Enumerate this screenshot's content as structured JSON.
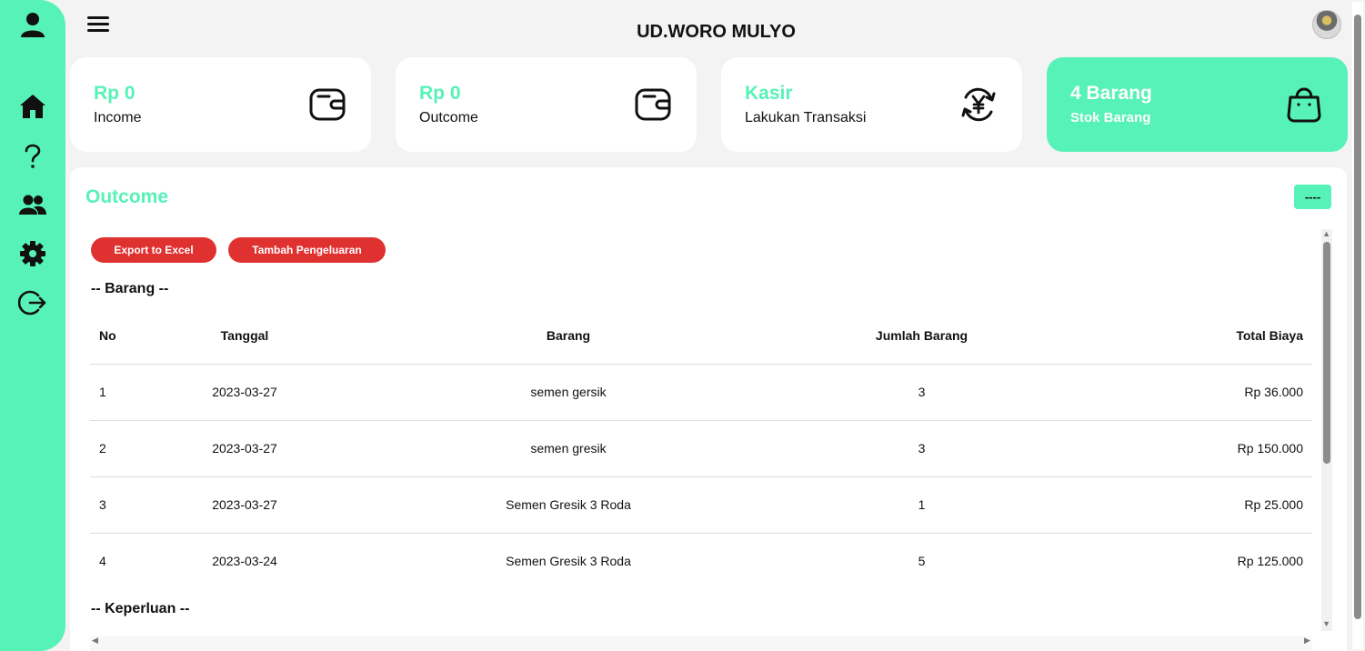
{
  "header": {
    "title": "UD.WORO MULYO"
  },
  "sidebar": {
    "items": [
      "user-icon",
      "home-icon",
      "help-icon",
      "users-icon",
      "gear-icon",
      "logout-icon"
    ]
  },
  "cards": [
    {
      "value": "Rp 0",
      "label": "Income",
      "icon": "wallet-icon"
    },
    {
      "value": "Rp 0",
      "label": "Outcome",
      "icon": "wallet-icon"
    },
    {
      "value": "Kasir",
      "label": "Lakukan Transaksi",
      "icon": "yen-exchange-icon"
    },
    {
      "value": "4 Barang",
      "label": "Stok Barang",
      "icon": "bag-icon"
    }
  ],
  "panel": {
    "title": "Outcome",
    "menu_label": "----",
    "export_label": "Export to Excel",
    "add_label": "Tambah Pengeluaran",
    "section_barang": "-- Barang --",
    "section_keperluan": "-- Keperluan --"
  },
  "table": {
    "headers": [
      "No",
      "Tanggal",
      "Barang",
      "Jumlah Barang",
      "Total Biaya"
    ],
    "rows": [
      [
        "1",
        "2023-03-27",
        "semen gersik",
        "3",
        "Rp 36.000"
      ],
      [
        "2",
        "2023-03-27",
        "semen gresik",
        "3",
        "Rp 150.000"
      ],
      [
        "3",
        "2023-03-27",
        "Semen Gresik 3 Roda",
        "1",
        "Rp 25.000"
      ],
      [
        "4",
        "2023-03-24",
        "Semen Gresik 3 Roda",
        "5",
        "Rp 125.000"
      ]
    ]
  },
  "colors": {
    "accent": "#56f2b7",
    "danger": "#e03131"
  }
}
